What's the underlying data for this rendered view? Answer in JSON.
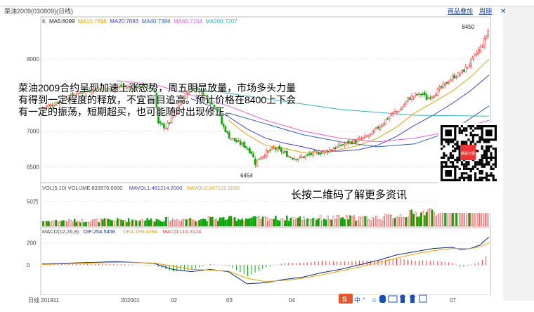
{
  "header": {
    "title": "菜油2009(030809)(日线)",
    "links": [
      "商品叠加",
      "周期"
    ],
    "close_glyph": "✕"
  },
  "annotation": "菜油2009合约呈现加速上涨态势，周五明显放量，市场多头力量有得到一定程度的释放，不宜盲目追高。预计价格在8400上下会有一定的振荡，短期超买，也可能随时出现修正。",
  "qr_caption": "长按二维码了解更多资讯",
  "qr_logo_text": "期货日报",
  "bottom_bar": {
    "period_label": "日线",
    "x_labels": [
      "201911",
      "202001",
      "02",
      "03",
      "04",
      "07"
    ],
    "icon_glyphs": [
      "中",
      "°",
      "☺",
      "🎤",
      "⌨",
      "👕",
      "👔",
      "▦"
    ]
  },
  "colors": {
    "up": "#ff3232",
    "down": "#00a800",
    "ma5": "#1c1c1c",
    "ma10": "#f0a000",
    "ma20": "#4040d0",
    "ma40": "#3060c0",
    "ma60": "#e060e0",
    "ma200": "#30b0c0",
    "dif": "#0a2a80",
    "dea": "#f0a000",
    "grid": "#d7d7d7",
    "logo": "#e33"
  },
  "chart_data": [
    {
      "type": "candlestick",
      "legend_prefix": "K",
      "legend": [
        {
          "label": "MA5:8099",
          "color": "#1c1c1c"
        },
        {
          "label": "MA10:7896",
          "color": "#f0a000"
        },
        {
          "label": "MA20:7693",
          "color": "#4040d0"
        },
        {
          "label": "MA40:7386",
          "color": "#3060c0"
        },
        {
          "label": "MA60:7154",
          "color": "#e060e0"
        },
        {
          "label": "MA200:7207",
          "color": "#30b0c0"
        }
      ],
      "y_ticks": [
        6500,
        7000,
        8000
      ],
      "ylim": [
        6300,
        8550
      ],
      "annotations": [
        {
          "text": "8450",
          "value": 8450
        },
        {
          "text": "6454",
          "value": 6454
        }
      ],
      "close_path": [
        [
          0,
          7330
        ],
        [
          6,
          7380
        ],
        [
          12,
          7450
        ],
        [
          18,
          7520
        ],
        [
          24,
          7560
        ],
        [
          30,
          7600
        ],
        [
          36,
          7580
        ],
        [
          42,
          7620
        ],
        [
          48,
          7600
        ],
        [
          54,
          7640
        ],
        [
          60,
          7560
        ],
        [
          62,
          7100
        ],
        [
          66,
          7050
        ],
        [
          70,
          7200
        ],
        [
          74,
          7400
        ],
        [
          78,
          7550
        ],
        [
          82,
          7600
        ],
        [
          86,
          7520
        ],
        [
          90,
          7400
        ],
        [
          94,
          7300
        ],
        [
          96,
          7100
        ],
        [
          100,
          6920
        ],
        [
          104,
          6850
        ],
        [
          108,
          6800
        ],
        [
          112,
          6700
        ],
        [
          114,
          6550
        ],
        [
          116,
          6620
        ],
        [
          120,
          6700
        ],
        [
          124,
          6760
        ],
        [
          128,
          6720
        ],
        [
          132,
          6650
        ],
        [
          136,
          6620
        ],
        [
          140,
          6640
        ],
        [
          144,
          6680
        ],
        [
          148,
          6700
        ],
        [
          152,
          6720
        ],
        [
          156,
          6760
        ],
        [
          160,
          6800
        ],
        [
          164,
          6840
        ],
        [
          168,
          6860
        ],
        [
          172,
          6900
        ],
        [
          176,
          6950
        ],
        [
          180,
          7050
        ],
        [
          184,
          7150
        ],
        [
          188,
          7250
        ],
        [
          192,
          7300
        ],
        [
          196,
          7450
        ],
        [
          200,
          7500
        ],
        [
          204,
          7520
        ],
        [
          206,
          7450
        ],
        [
          208,
          7480
        ],
        [
          212,
          7560
        ],
        [
          216,
          7650
        ],
        [
          220,
          7750
        ],
        [
          224,
          7800
        ],
        [
          228,
          7900
        ],
        [
          232,
          8050
        ],
        [
          236,
          8200
        ],
        [
          238,
          8330
        ],
        [
          240,
          8450
        ]
      ],
      "ma_paths": [
        {
          "name": "MA10",
          "color": "#f0a000",
          "values": [
            [
              100,
              7150
            ],
            [
              110,
              6950
            ],
            [
              120,
              6800
            ],
            [
              130,
              6760
            ],
            [
              140,
              6700
            ],
            [
              150,
              6700
            ],
            [
              160,
              6740
            ],
            [
              170,
              6800
            ],
            [
              180,
              6900
            ],
            [
              190,
              7050
            ],
            [
              200,
              7250
            ],
            [
              210,
              7400
            ],
            [
              220,
              7550
            ],
            [
              230,
              7750
            ],
            [
              240,
              8000
            ]
          ]
        },
        {
          "name": "MA20",
          "color": "#4040d0",
          "values": [
            [
              80,
              7450
            ],
            [
              90,
              7350
            ],
            [
              100,
              7200
            ],
            [
              110,
              7030
            ],
            [
              120,
              6900
            ],
            [
              130,
              6830
            ],
            [
              140,
              6780
            ],
            [
              150,
              6720
            ],
            [
              160,
              6720
            ],
            [
              170,
              6740
            ],
            [
              180,
              6800
            ],
            [
              190,
              6920
            ],
            [
              200,
              7080
            ],
            [
              210,
              7220
            ],
            [
              220,
              7380
            ],
            [
              230,
              7560
            ],
            [
              240,
              7780
            ]
          ]
        },
        {
          "name": "MA40",
          "color": "#3060c0",
          "values": [
            [
              100,
              7250
            ],
            [
              120,
              7100
            ],
            [
              140,
              6950
            ],
            [
              160,
              6850
            ],
            [
              180,
              6780
            ],
            [
              200,
              6820
            ],
            [
              220,
              7000
            ],
            [
              240,
              7350
            ]
          ]
        },
        {
          "name": "MA60",
          "color": "#e060e0",
          "values": [
            [
              40,
              7700
            ],
            [
              60,
              7650
            ],
            [
              80,
              7500
            ],
            [
              100,
              7350
            ],
            [
              120,
              7150
            ],
            [
              140,
              7000
            ],
            [
              160,
              6900
            ],
            [
              180,
              6850
            ],
            [
              200,
              6900
            ],
            [
              220,
              7000
            ],
            [
              240,
              7150
            ]
          ]
        },
        {
          "name": "MA200",
          "color": "#30b0c0",
          "values": [
            [
              80,
              7600
            ],
            [
              120,
              7450
            ],
            [
              160,
              7300
            ],
            [
              200,
              7220
            ],
            [
              240,
              7207
            ]
          ]
        }
      ],
      "bars_count": 240
    },
    {
      "type": "bar",
      "title": "VOL(5,10) VOLUME:833570.0000",
      "legend": [
        {
          "label": "MAVOL1:481214.2000",
          "color": "#4040d0"
        },
        {
          "label": "MAVOL2:347122.2000",
          "color": "#f0a000"
        }
      ],
      "y_ticks": [
        {
          "label": "50万",
          "value": 500000
        }
      ],
      "ylim": [
        0,
        850000
      ],
      "profile": [
        [
          0,
          120000
        ],
        [
          100,
          180000
        ],
        [
          180,
          200000
        ],
        [
          200,
          300000
        ],
        [
          220,
          420000
        ],
        [
          235,
          600000
        ],
        [
          240,
          833570
        ]
      ]
    },
    {
      "type": "bar",
      "title": "MACD(12,26,9)",
      "legend": [
        {
          "label": "DIF:254.5456",
          "color": "#0a2a80"
        },
        {
          "label": "DEA:199.4394",
          "color": "#f0a000"
        },
        {
          "label": "MACD:110.2124",
          "color": "#e04040"
        }
      ],
      "y_ticks": [
        0,
        200
      ],
      "ylim": [
        -260,
        300
      ],
      "dif_path": [
        [
          0,
          10
        ],
        [
          20,
          20
        ],
        [
          40,
          30
        ],
        [
          60,
          15
        ],
        [
          70,
          -40
        ],
        [
          80,
          -60
        ],
        [
          90,
          -40
        ],
        [
          100,
          -60
        ],
        [
          110,
          -170
        ],
        [
          120,
          -160
        ],
        [
          130,
          -130
        ],
        [
          140,
          -110
        ],
        [
          150,
          -70
        ],
        [
          160,
          -40
        ],
        [
          170,
          0
        ],
        [
          180,
          40
        ],
        [
          190,
          90
        ],
        [
          200,
          120
        ],
        [
          210,
          150
        ],
        [
          220,
          160
        ],
        [
          225,
          140
        ],
        [
          230,
          150
        ],
        [
          235,
          180
        ],
        [
          240,
          254.55
        ]
      ],
      "dea_path": [
        [
          0,
          5
        ],
        [
          20,
          15
        ],
        [
          40,
          25
        ],
        [
          60,
          18
        ],
        [
          70,
          -10
        ],
        [
          80,
          -40
        ],
        [
          90,
          -45
        ],
        [
          100,
          -55
        ],
        [
          110,
          -120
        ],
        [
          120,
          -150
        ],
        [
          130,
          -140
        ],
        [
          140,
          -120
        ],
        [
          150,
          -90
        ],
        [
          160,
          -55
        ],
        [
          170,
          -20
        ],
        [
          180,
          20
        ],
        [
          190,
          60
        ],
        [
          200,
          100
        ],
        [
          210,
          130
        ],
        [
          220,
          150
        ],
        [
          225,
          150
        ],
        [
          230,
          148
        ],
        [
          235,
          165
        ],
        [
          240,
          199.44
        ]
      ]
    }
  ]
}
